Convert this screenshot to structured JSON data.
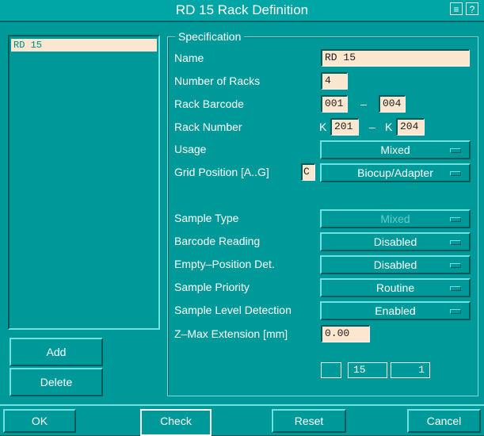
{
  "window": {
    "title": "RD 15 Rack Definition",
    "help_glyph": "?",
    "menu_glyph": "≡"
  },
  "rack_list": {
    "items": [
      "RD 15"
    ]
  },
  "side_buttons": {
    "add": "Add",
    "delete": "Delete"
  },
  "spec": {
    "title": "Specification",
    "name_label": "Name",
    "name_value": "RD 15",
    "num_racks_label": "Number of Racks",
    "num_racks_value": "4",
    "rack_barcode_label": "Rack Barcode",
    "rack_barcode_from": "001",
    "rack_barcode_to": "004",
    "rack_number_label": "Rack Number",
    "rack_number_prefix_from": "K",
    "rack_number_from": "201",
    "rack_number_prefix_to": "K",
    "rack_number_to": "204",
    "range_dash": "–",
    "usage_label": "Usage",
    "usage_value": "Mixed",
    "grid_label": "Grid Position [A..G]",
    "grid_value": "C",
    "grid_type_value": "Biocup/Adapter",
    "sample_type_label": "Sample Type",
    "sample_type_value": "Mixed",
    "barcode_reading_label": "Barcode Reading",
    "barcode_reading_value": "Disabled",
    "empty_pos_label": "Empty–Position Det.",
    "empty_pos_value": "Disabled",
    "priority_label": "Sample Priority",
    "priority_value": "Routine",
    "level_label": "Sample Level Detection",
    "level_value": "Enabled",
    "zmax_label": "Z–Max Extension [mm]",
    "zmax_value": "0.00",
    "pager_total": "15",
    "pager_current": "1"
  },
  "footer": {
    "ok": "OK",
    "check": "Check",
    "reset": "Reset",
    "cancel": "Cancel"
  }
}
